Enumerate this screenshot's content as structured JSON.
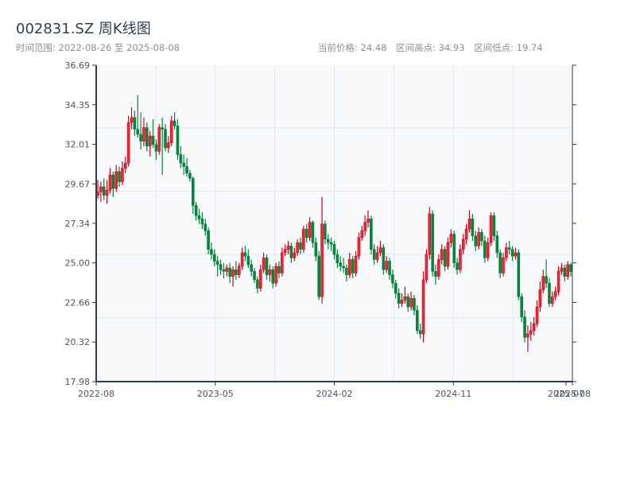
{
  "header": {
    "title": "002831.SZ 周K线图",
    "range_label": "时间范围: 2022-08-26 至 2025-08-08",
    "current_price": "当前价格: 24.48",
    "range_high": "区间高点: 34.93",
    "range_low": "区间低点: 19.74"
  },
  "colors": {
    "up": "#d9001b",
    "down": "#00873c",
    "axis": "#2c3e50",
    "plot_bg": "#f7f9fb",
    "grid": "#e3e6ec"
  },
  "chart_data": {
    "type": "candlestick",
    "title": "002831.SZ 周K线图",
    "frequency": "weekly",
    "start_date": "2022-08-26",
    "end_date": "2025-08-08",
    "ylim": [
      17.98,
      36.69
    ],
    "yticks": [
      "17.98",
      "20.32",
      "22.66",
      "25.00",
      "27.34",
      "29.67",
      "32.01",
      "34.35",
      "36.69"
    ],
    "xticks": [
      "2022-08",
      "2023-05",
      "2024-02",
      "2024-11",
      "2025-07",
      "2025-08"
    ],
    "up_color": "red",
    "down_color": "green",
    "grid": true,
    "ohlc_columns": [
      "open",
      "high",
      "low",
      "close"
    ],
    "ohlc": [
      [
        29.0,
        29.9,
        28.8,
        29.2
      ],
      [
        29.2,
        29.8,
        28.6,
        29.5
      ],
      [
        29.5,
        30.0,
        28.7,
        29.0
      ],
      [
        29.0,
        29.9,
        28.5,
        29.3
      ],
      [
        29.3,
        30.6,
        29.1,
        30.2
      ],
      [
        30.2,
        30.4,
        28.9,
        29.4
      ],
      [
        29.4,
        30.8,
        29.2,
        30.4
      ],
      [
        30.4,
        30.7,
        29.5,
        29.8
      ],
      [
        29.8,
        31.0,
        29.6,
        30.6
      ],
      [
        30.6,
        31.3,
        30.3,
        30.9
      ],
      [
        30.9,
        33.7,
        30.7,
        33.3
      ],
      [
        33.3,
        34.2,
        32.9,
        33.6
      ],
      [
        33.6,
        34.0,
        32.5,
        32.9
      ],
      [
        32.9,
        34.93,
        32.4,
        32.6
      ],
      [
        32.6,
        33.9,
        31.7,
        32.2
      ],
      [
        32.2,
        33.6,
        31.9,
        33.0
      ],
      [
        33.0,
        33.3,
        31.6,
        31.9
      ],
      [
        31.9,
        32.8,
        31.3,
        32.5
      ],
      [
        32.5,
        33.5,
        31.8,
        32.0
      ],
      [
        32.0,
        32.3,
        31.1,
        31.6
      ],
      [
        31.6,
        33.2,
        31.4,
        33.0
      ],
      [
        33.0,
        33.6,
        30.2,
        32.9
      ],
      [
        32.9,
        33.2,
        31.6,
        31.8
      ],
      [
        31.8,
        32.5,
        31.5,
        32.1
      ],
      [
        32.1,
        33.7,
        31.9,
        33.4
      ],
      [
        33.4,
        33.9,
        32.9,
        33.1
      ],
      [
        33.1,
        33.5,
        31.1,
        31.4
      ],
      [
        31.4,
        31.9,
        30.6,
        30.9
      ],
      [
        30.9,
        31.4,
        30.2,
        30.7
      ],
      [
        30.7,
        31.2,
        30.1,
        30.3
      ],
      [
        30.3,
        30.5,
        29.8,
        30.0
      ],
      [
        30.0,
        30.1,
        27.9,
        28.4
      ],
      [
        28.4,
        28.6,
        27.5,
        27.8
      ],
      [
        27.8,
        28.2,
        27.3,
        27.6
      ],
      [
        27.6,
        28.0,
        27.0,
        27.3
      ],
      [
        27.3,
        27.6,
        26.6,
        26.9
      ],
      [
        26.9,
        27.1,
        25.5,
        25.8
      ],
      [
        25.8,
        26.2,
        25.2,
        25.5
      ],
      [
        25.5,
        25.8,
        24.8,
        25.1
      ],
      [
        25.1,
        25.4,
        24.2,
        24.9
      ],
      [
        24.9,
        25.2,
        24.3,
        24.6
      ],
      [
        24.6,
        25.0,
        24.1,
        24.5
      ],
      [
        24.5,
        24.9,
        24.2,
        24.7
      ],
      [
        24.7,
        25.0,
        23.8,
        24.2
      ],
      [
        24.2,
        24.8,
        23.6,
        24.6
      ],
      [
        24.6,
        25.1,
        24.0,
        24.3
      ],
      [
        24.3,
        25.0,
        24.1,
        24.8
      ],
      [
        24.8,
        25.9,
        24.6,
        25.6
      ],
      [
        25.6,
        26.0,
        25.1,
        25.4
      ],
      [
        25.4,
        25.8,
        24.7,
        24.9
      ],
      [
        24.9,
        25.2,
        24.2,
        24.5
      ],
      [
        24.5,
        24.7,
        23.8,
        24.0
      ],
      [
        24.0,
        24.2,
        23.2,
        23.5
      ],
      [
        23.5,
        24.9,
        23.3,
        24.6
      ],
      [
        24.6,
        25.6,
        24.4,
        25.3
      ],
      [
        25.3,
        25.5,
        24.0,
        24.3
      ],
      [
        24.3,
        24.9,
        23.9,
        24.6
      ],
      [
        24.6,
        24.8,
        23.5,
        23.8
      ],
      [
        23.8,
        25.0,
        23.6,
        24.8
      ],
      [
        24.8,
        25.1,
        24.1,
        24.4
      ],
      [
        24.4,
        25.9,
        24.2,
        25.6
      ],
      [
        25.6,
        26.1,
        25.4,
        25.8
      ],
      [
        25.8,
        26.3,
        25.5,
        26.0
      ],
      [
        26.0,
        26.2,
        25.0,
        25.3
      ],
      [
        25.3,
        25.9,
        25.1,
        25.6
      ],
      [
        25.6,
        26.4,
        25.4,
        26.2
      ],
      [
        26.2,
        26.5,
        25.5,
        25.8
      ],
      [
        25.8,
        27.2,
        25.6,
        27.0
      ],
      [
        27.0,
        27.3,
        26.2,
        26.5
      ],
      [
        26.5,
        27.7,
        26.3,
        27.4
      ],
      [
        27.4,
        27.5,
        25.9,
        26.2
      ],
      [
        26.2,
        26.5,
        25.1,
        25.4
      ],
      [
        25.4,
        25.7,
        22.8,
        23.0
      ],
      [
        23.0,
        28.9,
        22.6,
        27.3
      ],
      [
        27.3,
        27.5,
        26.1,
        26.4
      ],
      [
        26.4,
        26.7,
        25.8,
        26.2
      ],
      [
        26.2,
        26.5,
        25.7,
        26.1
      ],
      [
        26.1,
        26.3,
        25.2,
        25.5
      ],
      [
        25.5,
        25.8,
        24.7,
        25.0
      ],
      [
        25.0,
        25.4,
        24.5,
        24.8
      ],
      [
        24.8,
        25.3,
        24.4,
        24.7
      ],
      [
        24.7,
        24.9,
        23.9,
        24.3
      ],
      [
        24.3,
        25.6,
        24.1,
        25.2
      ],
      [
        25.2,
        25.4,
        24.1,
        24.4
      ],
      [
        24.4,
        25.7,
        24.2,
        25.4
      ],
      [
        25.4,
        26.8,
        25.2,
        26.5
      ],
      [
        26.5,
        27.2,
        26.3,
        26.9
      ],
      [
        26.9,
        27.8,
        26.6,
        27.4
      ],
      [
        27.4,
        28.1,
        27.1,
        27.6
      ],
      [
        27.6,
        27.8,
        25.5,
        25.8
      ],
      [
        25.8,
        26.1,
        24.9,
        25.2
      ],
      [
        25.2,
        26.0,
        25.0,
        25.6
      ],
      [
        25.6,
        26.3,
        25.4,
        25.9
      ],
      [
        25.9,
        26.1,
        24.3,
        24.6
      ],
      [
        24.6,
        25.4,
        24.4,
        25.1
      ],
      [
        25.1,
        25.3,
        24.0,
        24.3
      ],
      [
        24.3,
        24.6,
        23.5,
        23.8
      ],
      [
        23.8,
        24.0,
        22.9,
        23.2
      ],
      [
        23.2,
        23.5,
        22.3,
        22.6
      ],
      [
        22.6,
        23.2,
        22.4,
        22.8
      ],
      [
        22.8,
        23.6,
        22.6,
        23.0
      ],
      [
        23.0,
        23.2,
        22.1,
        22.4
      ],
      [
        22.4,
        23.3,
        22.2,
        22.9
      ],
      [
        22.9,
        23.1,
        21.9,
        22.2
      ],
      [
        22.2,
        22.5,
        20.8,
        21.0
      ],
      [
        21.0,
        21.4,
        20.5,
        20.8
      ],
      [
        20.8,
        24.5,
        20.3,
        24.0
      ],
      [
        24.0,
        25.8,
        23.8,
        25.5
      ],
      [
        25.5,
        28.3,
        25.2,
        27.9
      ],
      [
        27.9,
        28.1,
        24.2,
        24.5
      ],
      [
        24.5,
        24.9,
        23.7,
        24.2
      ],
      [
        24.2,
        25.5,
        24.0,
        25.2
      ],
      [
        25.2,
        26.1,
        24.9,
        25.8
      ],
      [
        25.8,
        26.0,
        24.5,
        24.8
      ],
      [
        24.8,
        26.5,
        24.6,
        26.2
      ],
      [
        26.2,
        27.0,
        25.9,
        26.7
      ],
      [
        26.7,
        26.9,
        24.7,
        25.0
      ],
      [
        25.0,
        25.3,
        24.3,
        24.6
      ],
      [
        24.6,
        26.1,
        24.4,
        25.8
      ],
      [
        25.8,
        26.7,
        25.5,
        26.4
      ],
      [
        26.4,
        27.3,
        26.1,
        27.0
      ],
      [
        27.0,
        28.1,
        26.8,
        27.6
      ],
      [
        27.6,
        27.9,
        26.3,
        26.6
      ],
      [
        26.6,
        26.9,
        25.7,
        26.0
      ],
      [
        26.0,
        27.1,
        25.8,
        26.8
      ],
      [
        26.8,
        27.0,
        26.0,
        26.3
      ],
      [
        26.3,
        26.6,
        25.0,
        25.3
      ],
      [
        25.3,
        26.5,
        25.1,
        26.2
      ],
      [
        26.2,
        28.0,
        26.0,
        27.8
      ],
      [
        27.8,
        28.0,
        26.3,
        26.6
      ],
      [
        26.6,
        26.9,
        25.3,
        25.6
      ],
      [
        25.6,
        25.8,
        24.1,
        24.4
      ],
      [
        24.4,
        25.6,
        24.2,
        25.3
      ],
      [
        25.3,
        26.2,
        25.1,
        25.9
      ],
      [
        25.9,
        26.3,
        25.5,
        25.8
      ],
      [
        25.8,
        26.0,
        25.1,
        25.4
      ],
      [
        25.4,
        25.9,
        25.2,
        25.6
      ],
      [
        25.6,
        25.8,
        22.8,
        23.0
      ],
      [
        23.0,
        23.2,
        21.5,
        21.8
      ],
      [
        21.8,
        22.2,
        20.3,
        20.6
      ],
      [
        20.6,
        21.3,
        19.74,
        20.8
      ],
      [
        20.8,
        21.5,
        20.4,
        21.0
      ],
      [
        21.0,
        21.8,
        20.7,
        21.4
      ],
      [
        21.4,
        22.8,
        21.2,
        22.4
      ],
      [
        22.4,
        23.9,
        22.1,
        23.4
      ],
      [
        23.4,
        24.6,
        23.2,
        24.2
      ],
      [
        24.2,
        25.2,
        23.5,
        23.8
      ],
      [
        23.8,
        24.1,
        22.4,
        22.6
      ],
      [
        22.6,
        23.3,
        22.4,
        23.0
      ],
      [
        23.0,
        23.6,
        22.8,
        23.3
      ],
      [
        23.3,
        24.8,
        23.1,
        24.5
      ],
      [
        24.5,
        25.0,
        24.3,
        24.7
      ],
      [
        24.7,
        24.9,
        23.9,
        24.2
      ],
      [
        24.2,
        25.1,
        24.0,
        24.9
      ],
      [
        24.9,
        25.0,
        24.2,
        24.48
      ]
    ]
  }
}
